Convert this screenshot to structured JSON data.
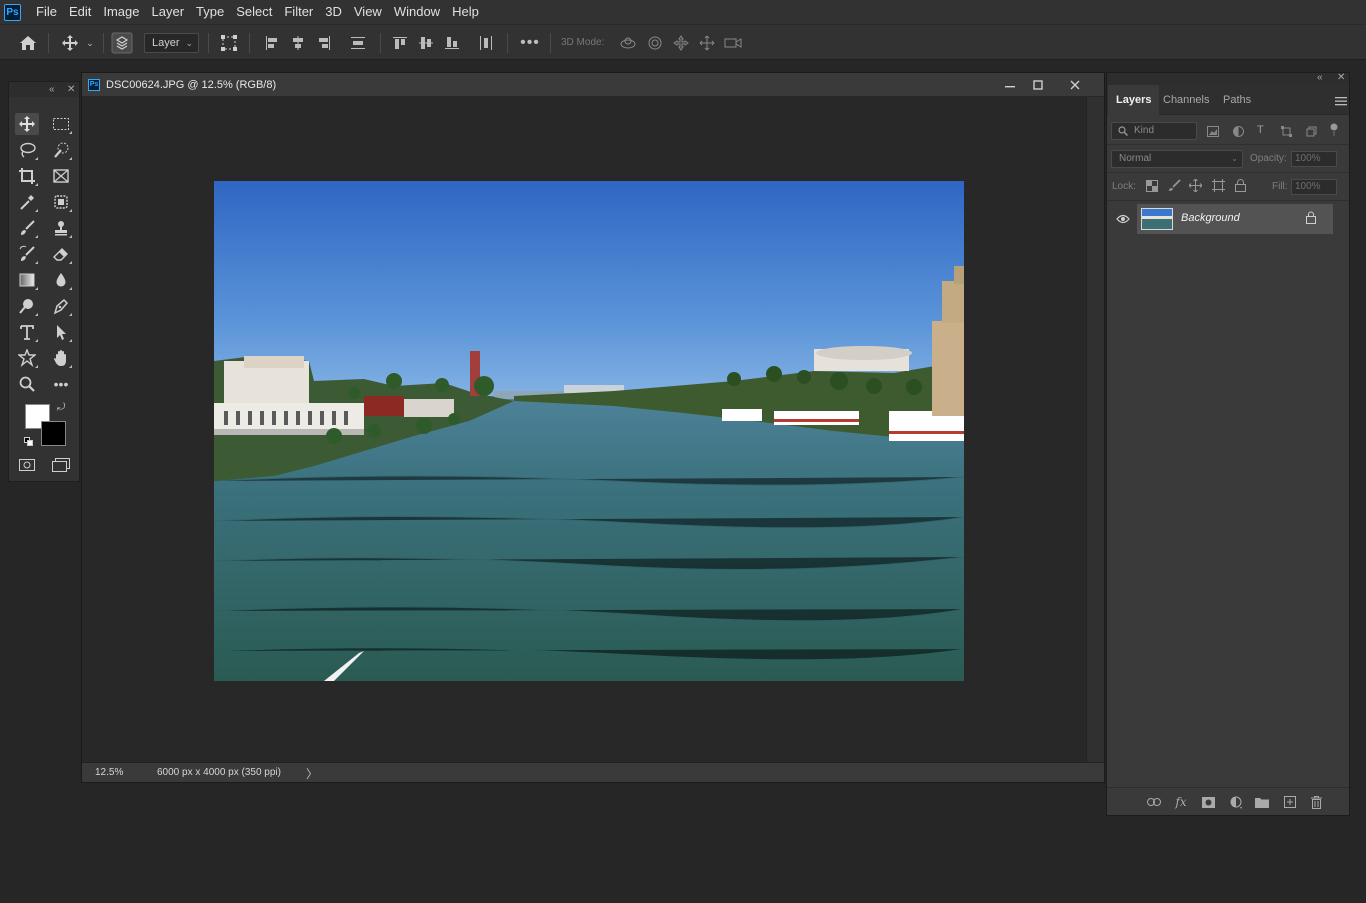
{
  "app": {
    "logo": "Ps"
  },
  "menu": [
    "File",
    "Edit",
    "Image",
    "Layer",
    "Type",
    "Select",
    "Filter",
    "3D",
    "View",
    "Window",
    "Help"
  ],
  "options": {
    "target_select": "Layer",
    "mode3d_label": "3D Mode:",
    "icons": [
      "home-icon",
      "move-icon",
      "auto-select-icon",
      "transform-controls-icon",
      "align-left-icon",
      "align-horizontal-center-icon",
      "align-right-icon",
      "distribute-vertical-icon",
      "align-top-icon",
      "align-vertical-center-icon",
      "align-bottom-icon",
      "distribute-horizontal-icon",
      "more-options-icon",
      "orbit-3d-icon",
      "roll-3d-icon",
      "pan-3d-icon",
      "slide-3d-icon",
      "camera-3d-icon"
    ]
  },
  "tools": {
    "foreground_color": "#ffffff",
    "background_color": "#000000",
    "items": [
      "move-tool",
      "marquee-tool",
      "lasso-tool",
      "quick-selection-tool",
      "crop-tool",
      "frame-tool",
      "eyedropper-tool",
      "patch-tool",
      "brush-tool",
      "stamp-tool",
      "history-brush-tool",
      "eraser-tool",
      "gradient-tool",
      "blur-tool",
      "dodge-tool",
      "pen-tool",
      "type-tool",
      "path-selection-tool",
      "shape-tool",
      "hand-tool",
      "zoom-tool",
      "more-tools",
      "quick-mask-mode",
      "screen-mode"
    ]
  },
  "document": {
    "title": "DSC00624.JPG @ 12.5% (RGB/8)",
    "zoom": "12.5%",
    "info": "6000 px x 4000 px (350 ppi)",
    "status_arrow": "〉"
  },
  "layers_panel": {
    "tabs": [
      "Layers",
      "Channels",
      "Paths"
    ],
    "active_tab": "Layers",
    "kind_placeholder": "Kind",
    "blend_mode": "Normal",
    "opacity_label": "Opacity:",
    "opacity_value": "100%",
    "lock_label": "Lock:",
    "fill_label": "Fill:",
    "fill_value": "100%",
    "layers": [
      {
        "name": "Background",
        "visible": true,
        "locked": true
      }
    ]
  }
}
